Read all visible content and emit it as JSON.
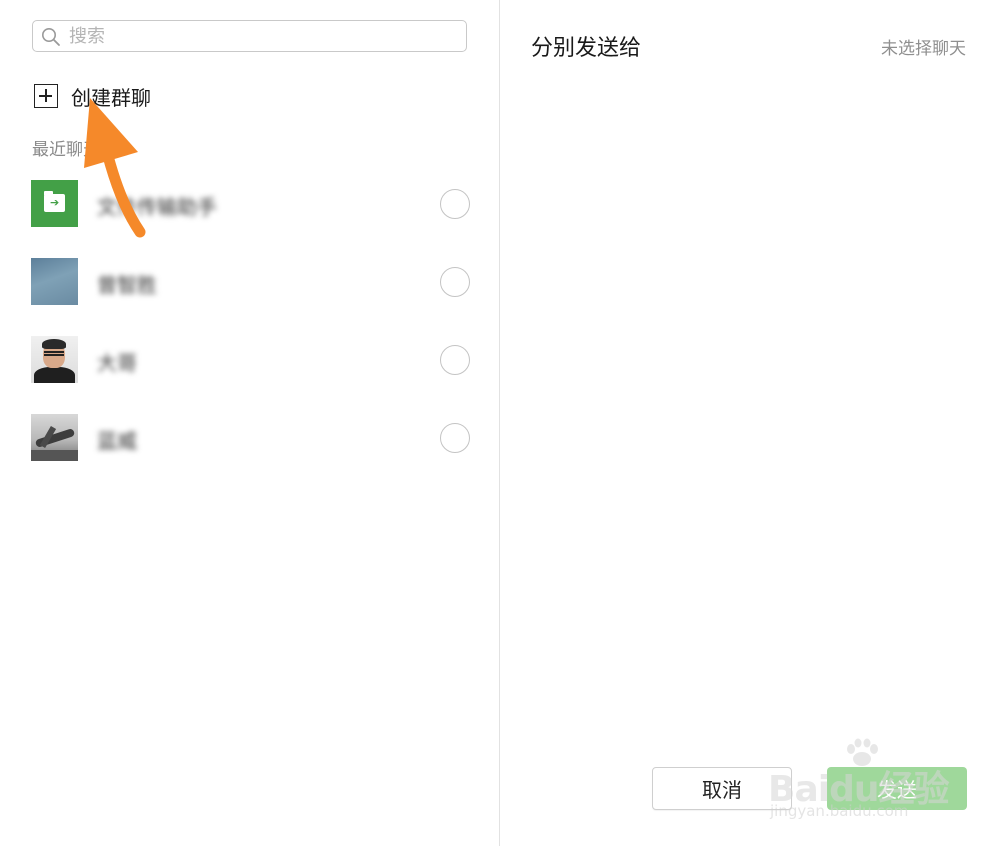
{
  "left_panel": {
    "search": {
      "placeholder": "搜索",
      "icon": "search-icon"
    },
    "create_group": {
      "label": "创建群聊",
      "icon": "plus-square-icon"
    },
    "recent_section_title": "最近聊天",
    "chats": [
      {
        "name": "文件传输助手",
        "avatar": "file-transfer-avatar",
        "selected": false
      },
      {
        "name": "曾智胜",
        "avatar": "sky-photo-avatar",
        "selected": false
      },
      {
        "name": "大哥",
        "avatar": "person-photo-avatar",
        "selected": false
      },
      {
        "name": "蓝威",
        "avatar": "aircraft-photo-avatar",
        "selected": false
      }
    ]
  },
  "right_panel": {
    "title": "分别发送给",
    "status": "未选择聊天",
    "cancel_label": "取消",
    "send_label": "发送"
  },
  "annotation": {
    "type": "arrow",
    "color": "#f5892a",
    "target": "create-group-button"
  },
  "watermark": {
    "brand": "Baidu经验",
    "url": "jingyan.baidu.com"
  },
  "colors": {
    "accent_green": "#9fd89b",
    "file_avatar_green": "#43a047",
    "arrow_orange": "#f5892a"
  }
}
